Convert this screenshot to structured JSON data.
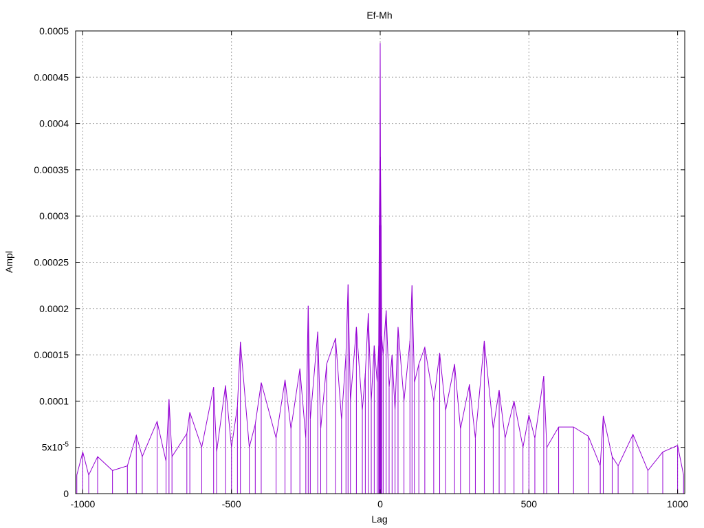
{
  "chart_data": {
    "type": "line",
    "title": "Ef-Mh",
    "xlabel": "Lag",
    "ylabel": "Ampl",
    "xlim": [
      -1024,
      1024
    ],
    "ylim": [
      0,
      0.0005
    ],
    "grid": true,
    "line_color": "#9400d3",
    "x_ticks": [
      {
        "value": -1000,
        "label": "-1000"
      },
      {
        "value": -500,
        "label": "-500"
      },
      {
        "value": 0,
        "label": "0"
      },
      {
        "value": 500,
        "label": "500"
      },
      {
        "value": 1000,
        "label": "1000"
      }
    ],
    "y_ticks": [
      {
        "value": 0,
        "label": "0"
      },
      {
        "value": 5e-05,
        "label": "5x10",
        "sup": "-5"
      },
      {
        "value": 0.0001,
        "label": "0.0001"
      },
      {
        "value": 0.00015,
        "label": "0.00015"
      },
      {
        "value": 0.0002,
        "label": "0.0002"
      },
      {
        "value": 0.00025,
        "label": "0.00025"
      },
      {
        "value": 0.0003,
        "label": "0.0003"
      },
      {
        "value": 0.00035,
        "label": "0.00035"
      },
      {
        "value": 0.0004,
        "label": "0.0004"
      },
      {
        "value": 0.00045,
        "label": "0.00045"
      },
      {
        "value": 0.0005,
        "label": "0.0005"
      }
    ],
    "series": [
      {
        "x": [
          -1020,
          -1000,
          -980,
          -950,
          -900,
          -850,
          -820,
          -800,
          -750,
          -720,
          -710,
          -700,
          -650,
          -640,
          -600,
          -560,
          -550,
          -520,
          -500,
          -480,
          -470,
          -440,
          -420,
          -400,
          -350,
          -320,
          -300,
          -270,
          -250,
          -242,
          -235,
          -210,
          -200,
          -180,
          -150,
          -130,
          -115,
          -108,
          -100,
          -80,
          -60,
          -50,
          -40,
          -30,
          -20,
          -10,
          -5,
          -3,
          -1,
          0,
          1,
          3,
          5,
          10,
          20,
          30,
          40,
          50,
          60,
          80,
          100,
          107,
          115,
          130,
          150,
          180,
          200,
          220,
          250,
          270,
          300,
          320,
          350,
          380,
          400,
          420,
          450,
          480,
          500,
          520,
          550,
          560,
          600,
          650,
          700,
          740,
          750,
          780,
          800,
          850,
          900,
          950,
          1000,
          1020
        ],
        "y": [
          2e-05,
          4.5e-05,
          2e-05,
          4e-05,
          2.5e-05,
          3e-05,
          6.3e-05,
          4e-05,
          7.8e-05,
          3.5e-05,
          0.000102,
          4e-05,
          6.5e-05,
          8.8e-05,
          5e-05,
          0.000115,
          4.5e-05,
          0.000117,
          5e-05,
          9.4e-05,
          0.000164,
          5e-05,
          7.5e-05,
          0.00012,
          6e-05,
          0.000123,
          7e-05,
          0.000135,
          6e-05,
          0.000203,
          8e-05,
          0.000175,
          7e-05,
          0.00014,
          0.000168,
          8e-05,
          0.00015,
          0.000226,
          0.0001,
          0.00018,
          9e-05,
          0.00013,
          0.000195,
          0.0001,
          0.00016,
          0.00012,
          0.00016,
          0.00029,
          0.00036,
          0.000487,
          0.000364,
          0.00029,
          0.00017,
          0.00015,
          0.000198,
          0.000115,
          0.00015,
          9e-05,
          0.00018,
          0.0001,
          0.000165,
          0.000225,
          0.00012,
          0.00014,
          0.000158,
          0.0001,
          0.000152,
          9e-05,
          0.00014,
          7e-05,
          0.000118,
          6e-05,
          0.000165,
          7e-05,
          0.000112,
          6e-05,
          0.0001,
          5e-05,
          8.5e-05,
          6e-05,
          0.000127,
          5e-05,
          7.2e-05,
          7.2e-05,
          6.2e-05,
          3e-05,
          8.4e-05,
          4e-05,
          3e-05,
          6.4e-05,
          2.5e-05,
          4.5e-05,
          5.2e-05,
          2e-05
        ]
      }
    ]
  }
}
